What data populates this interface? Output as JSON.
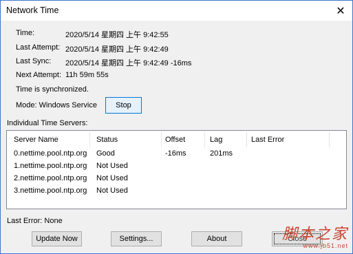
{
  "window": {
    "title": "Network Time",
    "close_glyph": "✕"
  },
  "info": {
    "time_label": "Time:",
    "time_value": "2020/5/14 星期四 上午 9:42:55",
    "last_attempt_label": "Last Attempt:",
    "last_attempt_value": "2020/5/14 星期四 上午 9:42:49",
    "last_sync_label": "Last Sync:",
    "last_sync_value": "2020/5/14 星期四 上午 9:42:49 -16ms",
    "next_attempt_label": "Next Attempt:",
    "next_attempt_value": "11h 59m 55s",
    "status_text": "Time is synchronized.",
    "mode_text": "Mode: Windows Service",
    "stop_label": "Stop"
  },
  "servers": {
    "section_label": "Individual Time Servers:",
    "columns": [
      "Server Name",
      "Status",
      "Offset",
      "Lag",
      "Last Error"
    ],
    "rows": [
      [
        "0.nettime.pool.ntp.org",
        "Good",
        "-16ms",
        "201ms",
        ""
      ],
      [
        "1.nettime.pool.ntp.org",
        "Not Used",
        "",
        "",
        ""
      ],
      [
        "2.nettime.pool.ntp.org",
        "Not Used",
        "",
        "",
        ""
      ],
      [
        "3.nettime.pool.ntp.org",
        "Not Used",
        "",
        "",
        ""
      ]
    ]
  },
  "footer": {
    "last_error": "Last Error:  None",
    "update_now_label": "Update Now",
    "settings_label": "Settings...",
    "about_label": "About",
    "close_label": "Close"
  },
  "watermark": {
    "main": "脚本之家",
    "url": "www.jb51.net"
  },
  "colors": {
    "accent": "#0078d7",
    "watermark": "#c8452f"
  }
}
